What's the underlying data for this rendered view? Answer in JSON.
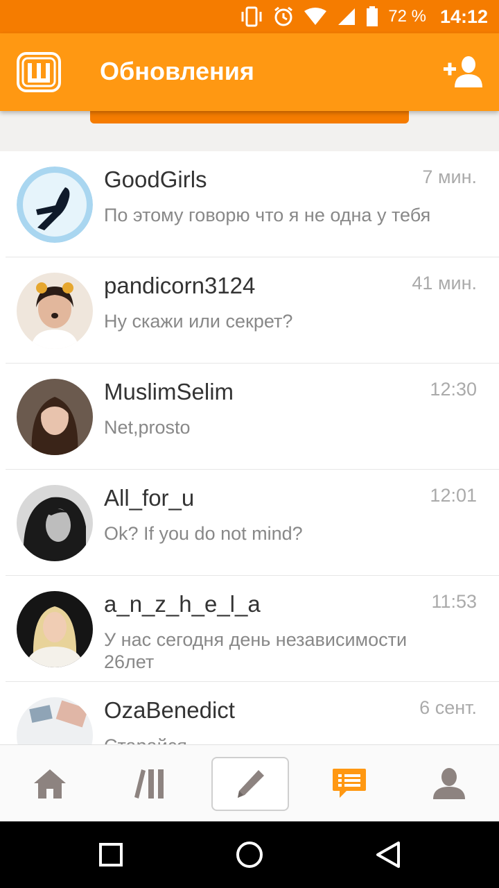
{
  "status_bar": {
    "battery": "72 %",
    "time": "14:12"
  },
  "header": {
    "title": "Обновления"
  },
  "conversations": [
    {
      "name": "GoodGirls",
      "time": "7 мин.",
      "preview": "По этому говорю что я не одна у тебя"
    },
    {
      "name": "pandicorn3124",
      "time": "41 мин.",
      "preview": "Ну скажи или секрет?"
    },
    {
      "name": "MuslimSelim",
      "time": "12:30",
      "preview": "Net,prosto"
    },
    {
      "name": "All_for_u",
      "time": "12:01",
      "preview": "Ok? If you do not mind?"
    },
    {
      "name": "a_n_z_h_e_l_a",
      "time": "11:53",
      "preview": " У нас сегодня день независимости 26лет"
    },
    {
      "name": "OzaBenedict",
      "time": "6 сент.",
      "preview": "Старайся"
    }
  ],
  "colors": {
    "accent": "#ff9812",
    "status": "#f57c00",
    "nav_icon": "#8d8380",
    "nav_active": "#ff9812"
  },
  "bottom_nav": [
    "home-icon",
    "library-icon",
    "write-icon",
    "messages-icon",
    "profile-icon"
  ]
}
